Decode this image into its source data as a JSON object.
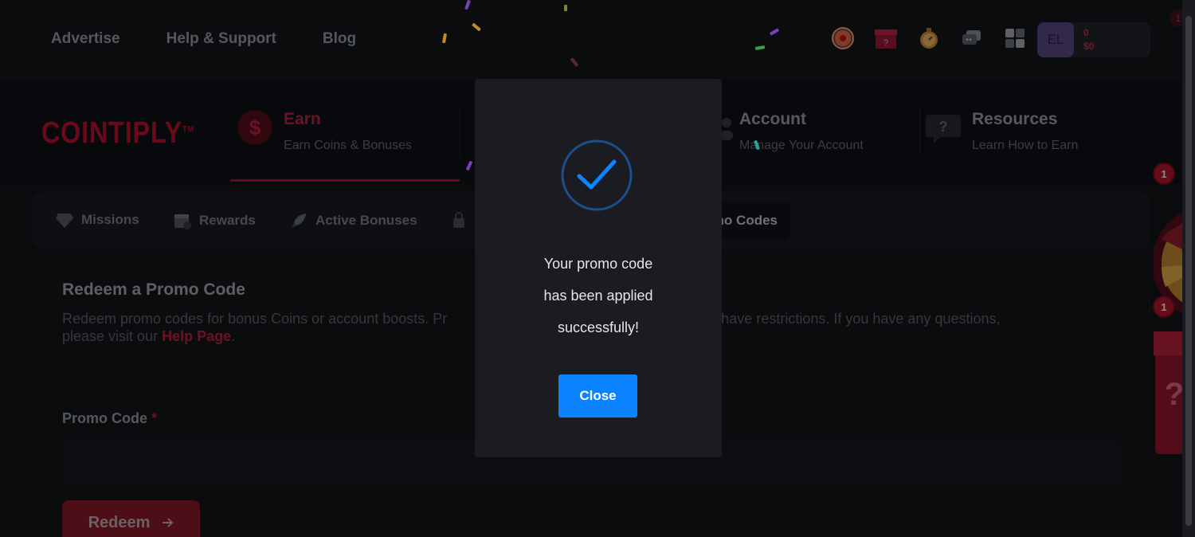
{
  "topbar": {
    "links": [
      "Advertise",
      "Help & Support",
      "Blog"
    ],
    "icons": [
      "wheel-icon",
      "mystery-box-icon",
      "stopwatch-icon",
      "chat-icon",
      "apps-grid-icon"
    ],
    "user": {
      "initials": "EL",
      "coins": "0",
      "dollars": "$0"
    },
    "notification_count": "1"
  },
  "brand": {
    "logo": "COINTIPLY",
    "tm": "TM"
  },
  "nav": {
    "earn": {
      "title": "Earn",
      "subtitle": "Earn Coins & Bonuses"
    },
    "account": {
      "title": "Account",
      "subtitle": "Manage Your Account"
    },
    "resources": {
      "title": "Resources",
      "subtitle": "Learn How to Earn"
    }
  },
  "tabs": {
    "missions": "Missions",
    "rewards": "Rewards",
    "active_bonuses": "Active Bonuses",
    "promo_codes_partial": "no Codes"
  },
  "promo": {
    "title": "Redeem a Promo Code",
    "desc_start": "Redeem promo codes for bonus Coins or account boosts. Pr",
    "desc_end": "and may have restrictions. If you have any questions,",
    "desc_line2": "please visit our ",
    "help_link": "Help Page",
    "desc_period": ".",
    "field_label": "Promo Code",
    "required_mark": "*",
    "input_value": "",
    "redeem_label": "Redeem"
  },
  "modal": {
    "line1": "Your promo code",
    "line2": "has been applied",
    "line3": "successfully!",
    "close_label": "Close"
  },
  "side": {
    "badge1": "1",
    "badge2": "1"
  },
  "colors": {
    "brand_red": "#c1122f",
    "modal_button": "#0d84ff",
    "check_blue": "#0d84ff"
  }
}
